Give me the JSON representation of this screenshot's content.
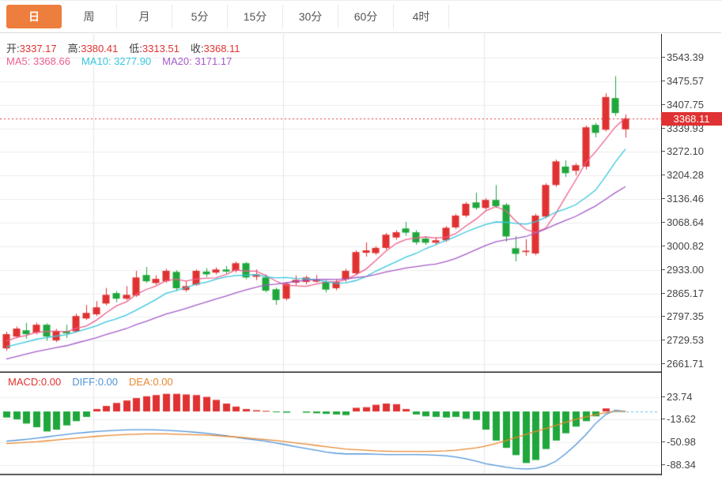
{
  "tabs": {
    "items": [
      {
        "name": "tab-day",
        "label": "日",
        "active": true
      },
      {
        "name": "tab-week",
        "label": "周",
        "active": false
      },
      {
        "name": "tab-month",
        "label": "月",
        "active": false
      },
      {
        "name": "tab-5min",
        "label": "5分",
        "active": false
      },
      {
        "name": "tab-15min",
        "label": "15分",
        "active": false
      },
      {
        "name": "tab-30min",
        "label": "30分",
        "active": false
      },
      {
        "name": "tab-60min",
        "label": "60分",
        "active": false
      },
      {
        "name": "tab-4hour",
        "label": "4时",
        "active": false
      }
    ]
  },
  "legend": {
    "ohlc": [
      {
        "label": "开:",
        "value": "3337.17"
      },
      {
        "label": "高:",
        "value": "3380.41"
      },
      {
        "label": "低:",
        "value": "3313.51"
      },
      {
        "label": "收:",
        "value": "3368.11"
      }
    ],
    "ma": [
      {
        "label": "MA5:",
        "value": "3368.66",
        "color": "#ee5f8d"
      },
      {
        "label": "MA10:",
        "value": "3277.90",
        "color": "#36c6dd"
      },
      {
        "label": "MA20:",
        "value": "3171.17",
        "color": "#a45bc8"
      }
    ]
  },
  "macd_legend": [
    {
      "label": "MACD:",
      "value": "0.00",
      "color": "#e03232"
    },
    {
      "label": "DIFF:",
      "value": "0.00",
      "color": "#4f93d8"
    },
    {
      "label": "DEA:",
      "value": "0.00",
      "color": "#e8872f"
    }
  ],
  "price_axis": {
    "labels": [
      "3543.39",
      "3475.57",
      "3407.75",
      "3339.93",
      "3272.10",
      "3204.28",
      "3136.46",
      "3068.64",
      "3000.82",
      "2933.00",
      "2865.17",
      "2797.35",
      "2729.53",
      "2661.71"
    ],
    "last_price": "3368.11"
  },
  "macd_axis": {
    "labels": [
      "23.74",
      "-13.62",
      "-50.98",
      "-88.34"
    ]
  },
  "colors": {
    "up": "#e03232",
    "down": "#1fa73c",
    "ma5": "#ee5f8d",
    "ma10": "#36c6dd",
    "ma20": "#a45bc8",
    "diff": "#4f93d8",
    "dea": "#e8872f",
    "tab_active_bg": "#ee7e3d",
    "axis_text": "#444444",
    "grid": "#ececec",
    "vgrid": "#e6e6e6",
    "badge_bg": "#e03232",
    "zero_dash": "#7ecbe8"
  },
  "chart_data": [
    {
      "type": "candlestick",
      "title": "日K线 (daily K-line)",
      "y_ticks": [
        3543.39,
        3475.57,
        3407.75,
        3339.93,
        3272.1,
        3204.28,
        3136.46,
        3068.64,
        3000.82,
        2933.0,
        2865.17,
        2797.35,
        2729.53,
        2661.71
      ],
      "last_price": 3368.11,
      "legend_values": {
        "MA5": 3368.66,
        "MA10": 3277.9,
        "MA20": 3171.17
      },
      "ohlc_current": {
        "open": 3337.17,
        "high": 3380.41,
        "low": 3313.51,
        "close": 3368.11
      },
      "v_grid_x": [
        118,
        358,
        612
      ],
      "ma_periods": [
        5,
        10,
        20
      ],
      "ma_seed_closes": [
        2610,
        2617,
        2624,
        2631,
        2638,
        2645,
        2652,
        2659,
        2666,
        2673,
        2680,
        2687,
        2694,
        2700,
        2707,
        2713,
        2720,
        2726,
        2733
      ],
      "candles": [
        [
          2707,
          2755,
          2700,
          2748
        ],
        [
          2741,
          2770,
          2736,
          2764
        ],
        [
          2759,
          2780,
          2735,
          2748
        ],
        [
          2752,
          2781,
          2747,
          2775
        ],
        [
          2775,
          2779,
          2729,
          2741
        ],
        [
          2730,
          2763,
          2725,
          2757
        ],
        [
          2757,
          2775,
          2737,
          2750
        ],
        [
          2756,
          2807,
          2752,
          2800
        ],
        [
          2793,
          2832,
          2789,
          2809
        ],
        [
          2805,
          2843,
          2800,
          2825
        ],
        [
          2836,
          2881,
          2831,
          2861
        ],
        [
          2866,
          2872,
          2840,
          2850
        ],
        [
          2850,
          2886,
          2846,
          2861
        ],
        [
          2859,
          2930,
          2855,
          2911
        ],
        [
          2918,
          2941,
          2895,
          2900
        ],
        [
          2895,
          2917,
          2890,
          2907
        ],
        [
          2900,
          2936,
          2896,
          2930
        ],
        [
          2927,
          2932,
          2872,
          2880
        ],
        [
          2875,
          2900,
          2870,
          2886
        ],
        [
          2890,
          2934,
          2887,
          2930
        ],
        [
          2928,
          2938,
          2913,
          2920
        ],
        [
          2925,
          2940,
          2920,
          2934
        ],
        [
          2934,
          2944,
          2922,
          2928
        ],
        [
          2930,
          2957,
          2925,
          2952
        ],
        [
          2952,
          2956,
          2906,
          2911
        ],
        [
          2913,
          2934,
          2903,
          2920
        ],
        [
          2911,
          2920,
          2868,
          2873
        ],
        [
          2877,
          2882,
          2832,
          2846
        ],
        [
          2850,
          2898,
          2845,
          2893
        ],
        [
          2896,
          2917,
          2889,
          2904
        ],
        [
          2898,
          2916,
          2891,
          2911
        ],
        [
          2899,
          2918,
          2896,
          2906
        ],
        [
          2898,
          2903,
          2868,
          2876
        ],
        [
          2880,
          2906,
          2874,
          2898
        ],
        [
          2905,
          2936,
          2899,
          2930
        ],
        [
          2923,
          2989,
          2918,
          2984
        ],
        [
          2982,
          3012,
          2971,
          2989
        ],
        [
          2981,
          3001,
          2976,
          2996
        ],
        [
          2996,
          3039,
          2991,
          3034
        ],
        [
          3026,
          3047,
          3020,
          3041
        ],
        [
          3052,
          3071,
          3031,
          3040
        ],
        [
          3041,
          3047,
          3005,
          3012
        ],
        [
          3023,
          3029,
          3005,
          3011
        ],
        [
          3011,
          3027,
          3004,
          3018
        ],
        [
          3018,
          3059,
          3013,
          3054
        ],
        [
          3055,
          3094,
          3050,
          3089
        ],
        [
          3089,
          3128,
          3084,
          3123
        ],
        [
          3127,
          3155,
          3106,
          3111
        ],
        [
          3111,
          3139,
          3106,
          3134
        ],
        [
          3134,
          3177,
          3111,
          3116
        ],
        [
          3120,
          3125,
          3014,
          3029
        ],
        [
          2995,
          3030,
          2957,
          2979
        ],
        [
          2984,
          3021,
          2973,
          2988
        ],
        [
          2980,
          3094,
          2975,
          3089
        ],
        [
          3086,
          3182,
          3081,
          3177
        ],
        [
          3177,
          3250,
          3172,
          3245
        ],
        [
          3230,
          3248,
          3200,
          3211
        ],
        [
          3218,
          3240,
          3205,
          3234
        ],
        [
          3230,
          3348,
          3222,
          3343
        ],
        [
          3350,
          3356,
          3314,
          3327
        ],
        [
          3336,
          3441,
          3331,
          3430
        ],
        [
          3427,
          3490,
          3376,
          3384
        ],
        [
          3337.17,
          3380.41,
          3313.51,
          3368.11
        ]
      ]
    },
    {
      "type": "macd",
      "y_ticks": [
        23.74,
        -13.62,
        -50.98,
        -88.34
      ],
      "legend_values": {
        "MACD": 0.0,
        "DIFF": 0.0,
        "DEA": 0.0
      },
      "macd": [
        -10,
        -13,
        -20,
        -26,
        -33,
        -30,
        -23,
        -16,
        -9,
        4,
        9,
        14,
        18,
        22,
        25,
        27,
        29,
        29,
        28,
        27,
        24,
        19,
        13,
        8,
        4,
        2,
        1,
        -1,
        -2,
        0,
        -2,
        -3,
        -4,
        -5,
        -6,
        6,
        7,
        11,
        13,
        12,
        4,
        -5,
        -8,
        -9,
        -10,
        -9,
        -12,
        -14,
        -30,
        -48,
        -60,
        -72,
        -85,
        -80,
        -62,
        -48,
        -36,
        -25,
        -16,
        -8,
        5,
        0,
        0
      ],
      "diff": [
        -49,
        -47.5,
        -46,
        -44,
        -42,
        -40,
        -38,
        -36,
        -34.5,
        -33,
        -32,
        -31,
        -30.5,
        -30,
        -30,
        -30.5,
        -31,
        -32,
        -33,
        -34.5,
        -36,
        -38,
        -40,
        -42.5,
        -45,
        -47,
        -49,
        -52,
        -55,
        -58,
        -61,
        -64,
        -67,
        -69,
        -70,
        -70,
        -70,
        -70.5,
        -71,
        -71,
        -71,
        -71,
        -71.5,
        -72,
        -73,
        -75,
        -78,
        -82,
        -86,
        -89,
        -92,
        -94,
        -95,
        -94,
        -90,
        -82,
        -70,
        -55,
        -38,
        -20,
        -5,
        2,
        0
      ],
      "dea": [
        -53,
        -52,
        -51,
        -50,
        -48.5,
        -47,
        -45.5,
        -44,
        -42.5,
        -41,
        -40,
        -39,
        -38,
        -37.5,
        -37,
        -37,
        -37,
        -37.5,
        -38,
        -38.5,
        -39,
        -40,
        -41,
        -42,
        -43.5,
        -45,
        -46.5,
        -48,
        -50,
        -52,
        -54,
        -56,
        -58,
        -60,
        -62,
        -63,
        -64,
        -65,
        -65.5,
        -66,
        -66,
        -66,
        -66,
        -65.5,
        -65,
        -64,
        -62,
        -60,
        -57,
        -53,
        -48,
        -43,
        -38,
        -33,
        -28,
        -23,
        -18,
        -13,
        -9,
        -5,
        -2,
        0,
        0
      ]
    }
  ]
}
